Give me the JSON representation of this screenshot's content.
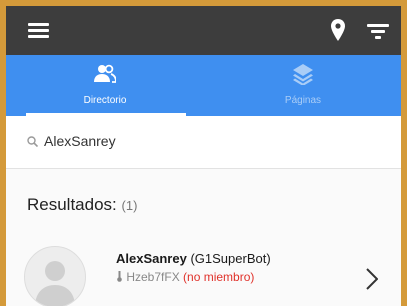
{
  "tabs": [
    {
      "label": "Directorio",
      "icon": "people-icon",
      "active": true
    },
    {
      "label": "Páginas",
      "icon": "layers-icon",
      "active": false
    }
  ],
  "search": {
    "value": "AlexSanrey"
  },
  "results": {
    "label": "Resultados:",
    "count": "(1)",
    "items": [
      {
        "name": "AlexSanrey",
        "alias": "(G1SuperBot)",
        "id": "Hzeb7fFX",
        "status": "(no miembro)"
      }
    ]
  },
  "colors": {
    "topbar": "#3d3d3d",
    "tabbar": "#3f8ff0",
    "status": "#e0322b",
    "frame": "#d49a3a"
  }
}
